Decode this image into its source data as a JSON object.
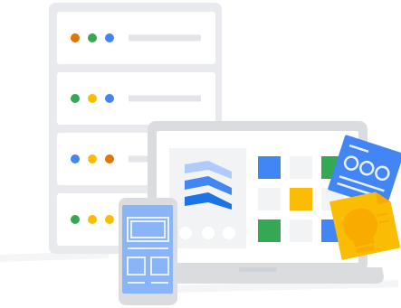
{
  "colors": {
    "server_frame": "#e8eaed",
    "server_rack": "#ffffff",
    "server_line": "#e3e5e8",
    "laptop_frame": "#dadce0",
    "laptop_screen": "#ffffff",
    "laptop_panel": "#f1f3f4",
    "laptop_base": "#dadce0",
    "laptop_base_shadow": "#cfd2d6",
    "phone_body": "#dadce0",
    "phone_screen": "#8ab4f8",
    "phone_outline": "#e8f0fe",
    "blue": "#4285f4",
    "blue_dark": "#1a73e8",
    "blue_light": "#aecbfa",
    "green": "#34a853",
    "yellow": "#fbbc04",
    "yellow_dark": "#f9ab00",
    "orange": "#e37400",
    "light_tile": "#f1f3f4",
    "shadow": "#f1f3f4"
  },
  "server": {
    "racks": [
      {
        "dots": [
          "#e37400",
          "#34a853",
          "#4285f4"
        ]
      },
      {
        "dots": [
          "#34a853",
          "#fbbc04",
          "#4285f4"
        ]
      },
      {
        "dots": [
          "#4285f4",
          "#fbbc04",
          "#e37400"
        ]
      },
      {
        "dots": [
          "#34a853",
          "#fbbc04",
          "#fbbc04"
        ]
      }
    ]
  },
  "laptop": {
    "grid": [
      [
        "#4285f4",
        "#f1f3f4",
        "#34a853"
      ],
      [
        "#f1f3f4",
        "#fbbc04",
        "#f1f3f4"
      ],
      [
        "#34a853",
        "#f1f3f4",
        "#4285f4"
      ]
    ]
  },
  "icons": {
    "logo": "stacked-chevron-logo-icon",
    "document": "document-card-icon",
    "idea": "lightbulb-note-icon"
  }
}
